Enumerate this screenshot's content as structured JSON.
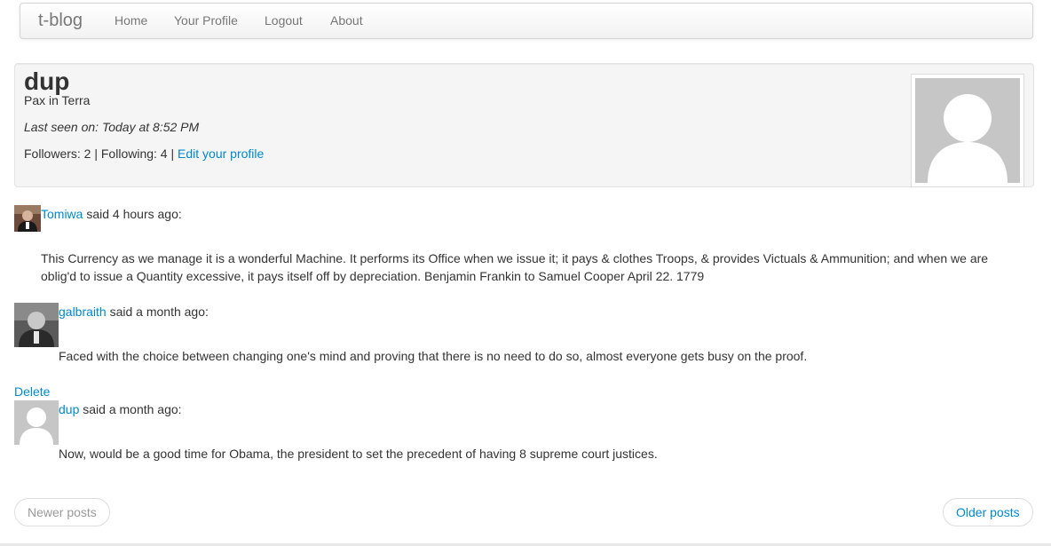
{
  "navbar": {
    "brand": "t-blog",
    "links": [
      "Home",
      "Your Profile",
      "Logout",
      "About"
    ]
  },
  "profile": {
    "username": "dup",
    "about": "Pax in Terra",
    "last_seen": "Last seen on: Today at 8:52 PM",
    "follow_text": "Followers: 2 | Following: 4 |",
    "edit_link": "Edit your profile",
    "avatar_icon": "default-user-silhouette"
  },
  "posts": [
    {
      "author": "Tomiwa",
      "meta": "said 4 hours ago:",
      "body": "This Currency as we manage it is a wonderful Machine. It performs its Office when we issue it; it pays & clothes Troops, & provides Victuals & Ammunition; and when we are oblig'd to issue a Quantity excessive, it pays itself off by depreciation. Benjamin Frankin to Samuel Cooper April 22. 1779"
    },
    {
      "author": "galbraith",
      "meta": "said a month ago:",
      "body": "Faced with the choice between changing one's mind and proving that there is no need to do so, almost everyone gets busy on the proof."
    },
    {
      "delete_label": "Delete",
      "author": "dup",
      "meta": "said a month ago:",
      "body": "Now, would be a good time for Obama, the president to set the precedent of having 8 supreme court justices."
    }
  ],
  "pager": {
    "newer": "Newer posts",
    "older": "Older posts"
  },
  "colors": {
    "link": "#0088cc",
    "disabled": "#999999",
    "avatar_gray": "#c6c6c6"
  }
}
